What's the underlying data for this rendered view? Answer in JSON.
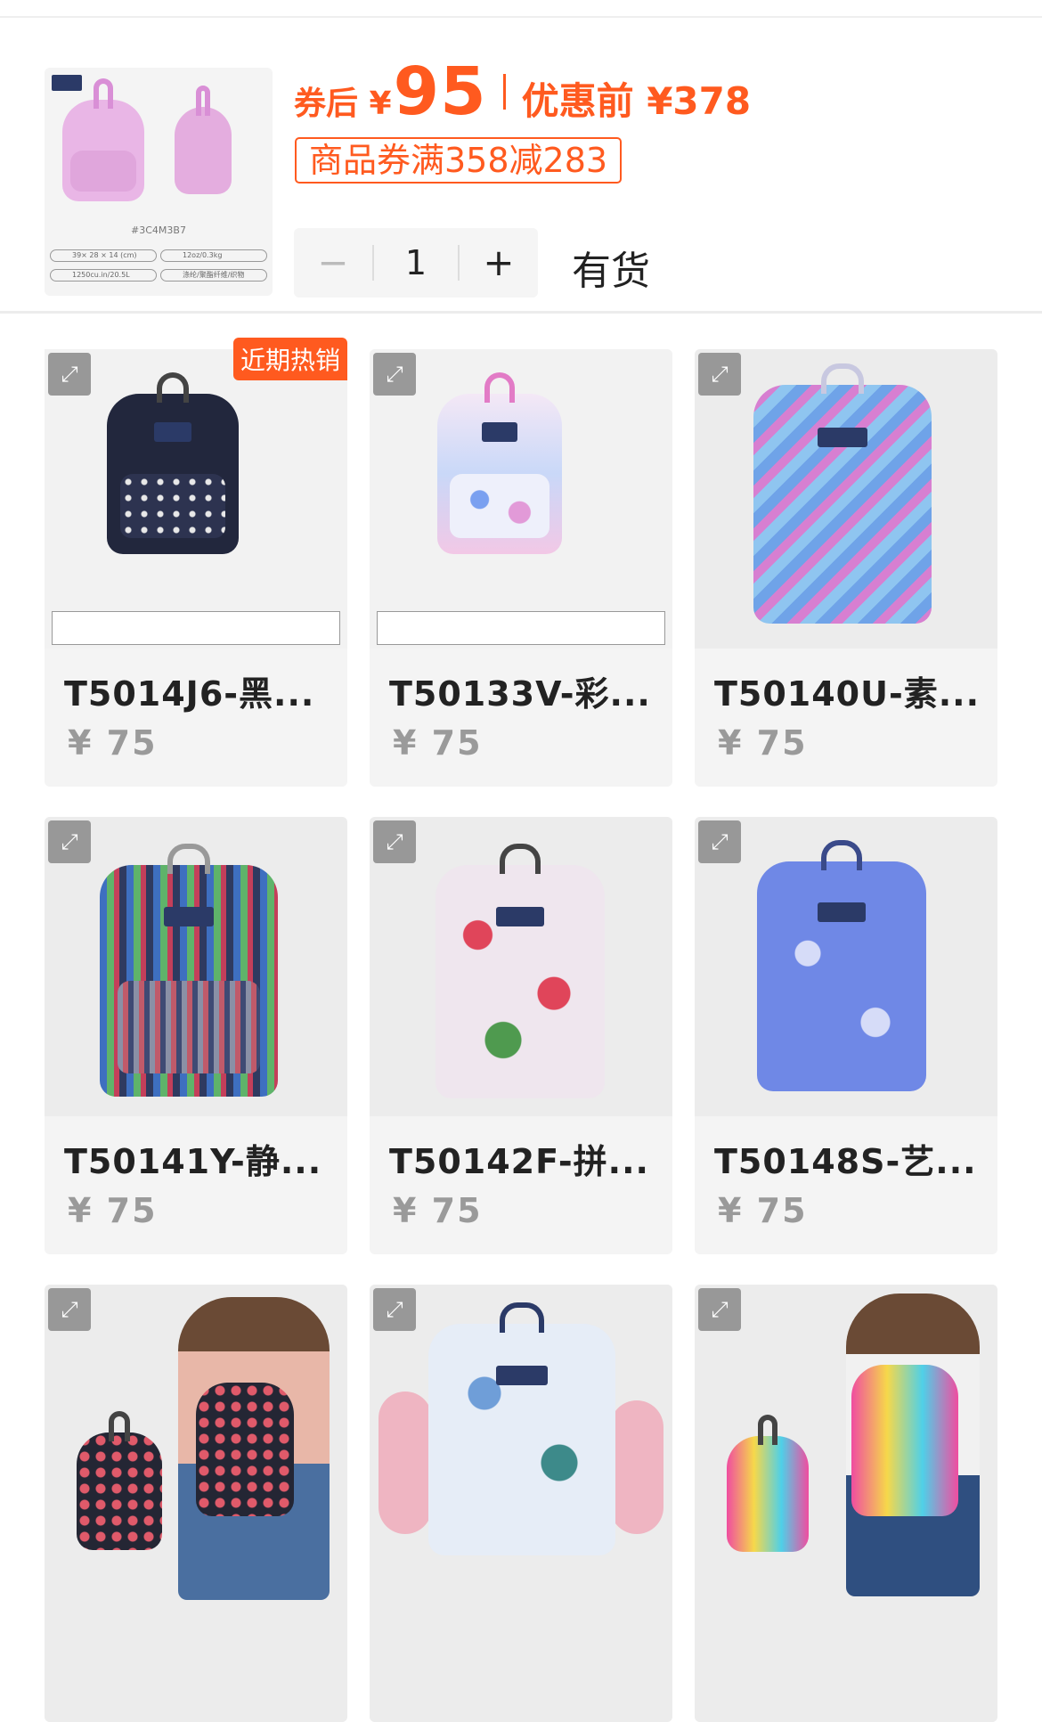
{
  "summary": {
    "thumb_sku": "#3C4M3B7",
    "thumb_specs": [
      [
        "39× 28 × 14 (cm)",
        "12oz/0.3kg"
      ],
      [
        "1250cu.in/20.5L",
        "涤纶/聚酯纤维/织物"
      ]
    ],
    "price_after_label": "券后 ¥",
    "price_after_value": "95",
    "price_before": "优惠前 ¥378",
    "coupon": "商品券满358减283",
    "qty_minus": "−",
    "qty": "1",
    "qty_plus": "+",
    "stock": "有货"
  },
  "products": [
    {
      "title": "T5014J6-黑...",
      "price": "¥ 75",
      "badge": "近期热销"
    },
    {
      "title": "T50133V-彩...",
      "price": "¥ 75",
      "badge": ""
    },
    {
      "title": "T50140U-素...",
      "price": "¥ 75",
      "badge": ""
    },
    {
      "title": "T50141Y-静...",
      "price": "¥ 75",
      "badge": ""
    },
    {
      "title": "T50142F-拼...",
      "price": "¥ 75",
      "badge": ""
    },
    {
      "title": "T50148S-艺...",
      "price": "¥ 75",
      "badge": ""
    },
    {
      "title": "",
      "price": "",
      "badge": ""
    },
    {
      "title": "",
      "price": "",
      "badge": ""
    },
    {
      "title": "",
      "price": "",
      "badge": ""
    }
  ],
  "icons": {
    "expand": "expand-icon"
  },
  "colors": {
    "accent": "#ff5a1f",
    "price_grey": "#9a9a9a"
  }
}
